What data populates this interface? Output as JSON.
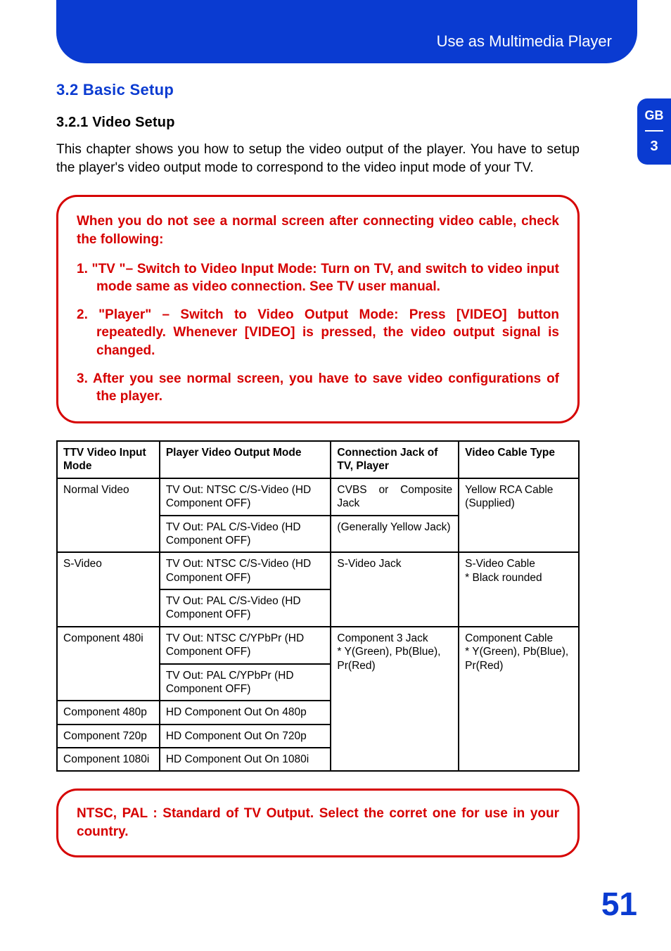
{
  "header": {
    "title": "Use as Multimedia Player"
  },
  "sidetab": {
    "lang": "GB",
    "chapter": "3"
  },
  "section": {
    "heading": "3.2 Basic Setup",
    "subheading": "3.2.1 Video Setup",
    "intro": "This chapter shows you how to setup the video output of the player. You have to setup the player's video output mode to correspond to the video input mode of your TV."
  },
  "callout1": {
    "title": "When you do not see a normal screen after connecting video cable, check the following:",
    "item1": "1. \"TV \"– Switch to Video Input Mode: Turn on TV, and switch to video input mode same as video connection. See TV user manual.",
    "item2": "2. \"Player\" – Switch to Video Output Mode: Press [VIDEO] button repeatedly. Whenever [VIDEO] is pressed, the video output signal is changed.",
    "item3": "3. After you see normal screen, you have to save video configurations of the player."
  },
  "table": {
    "headers": {
      "c1": "TTV Video Input Mode",
      "c2": "Player Video Output Mode",
      "c3": "Connection Jack of TV, Player",
      "c4": "Video Cable Type"
    },
    "cells": {
      "normal_video": "Normal Video",
      "ntsc_cs": "TV Out: NTSC C/S-Video (HD Component OFF)",
      "pal_cs": "TV Out: PAL C/S-Video (HD Component OFF)",
      "cvbs": "CVBS or Composite Jack",
      "gen_yellow": "(Generally Yellow Jack)",
      "yellow_rca": "Yellow RCA Cable (Supplied)",
      "svideo": "S-Video",
      "svideo_jack": "S-Video Jack",
      "svideo_cable": "S-Video Cable\n* Black rounded",
      "comp480i": "Component 480i",
      "ntsc_ypbpr": "TV Out: NTSC C/YPbPr (HD Component OFF)",
      "pal_ypbpr": "TV Out: PAL C/YPbPr (HD Component OFF)",
      "comp_jack": "Component 3 Jack\n* Y(Green), Pb(Blue), Pr(Red)",
      "comp_cable": "Component Cable\n* Y(Green), Pb(Blue), Pr(Red)",
      "comp480p": "Component 480p",
      "hd480p": "HD Component Out On 480p",
      "comp720p": "Component 720p",
      "hd720p": "HD Component Out On 720p",
      "comp1080i": "Component 1080i",
      "hd1080i": "HD Component Out On 1080i"
    }
  },
  "callout2": {
    "text": "NTSC, PAL : Standard of TV Output. Select the corret one for use in your country."
  },
  "page_number": "51"
}
